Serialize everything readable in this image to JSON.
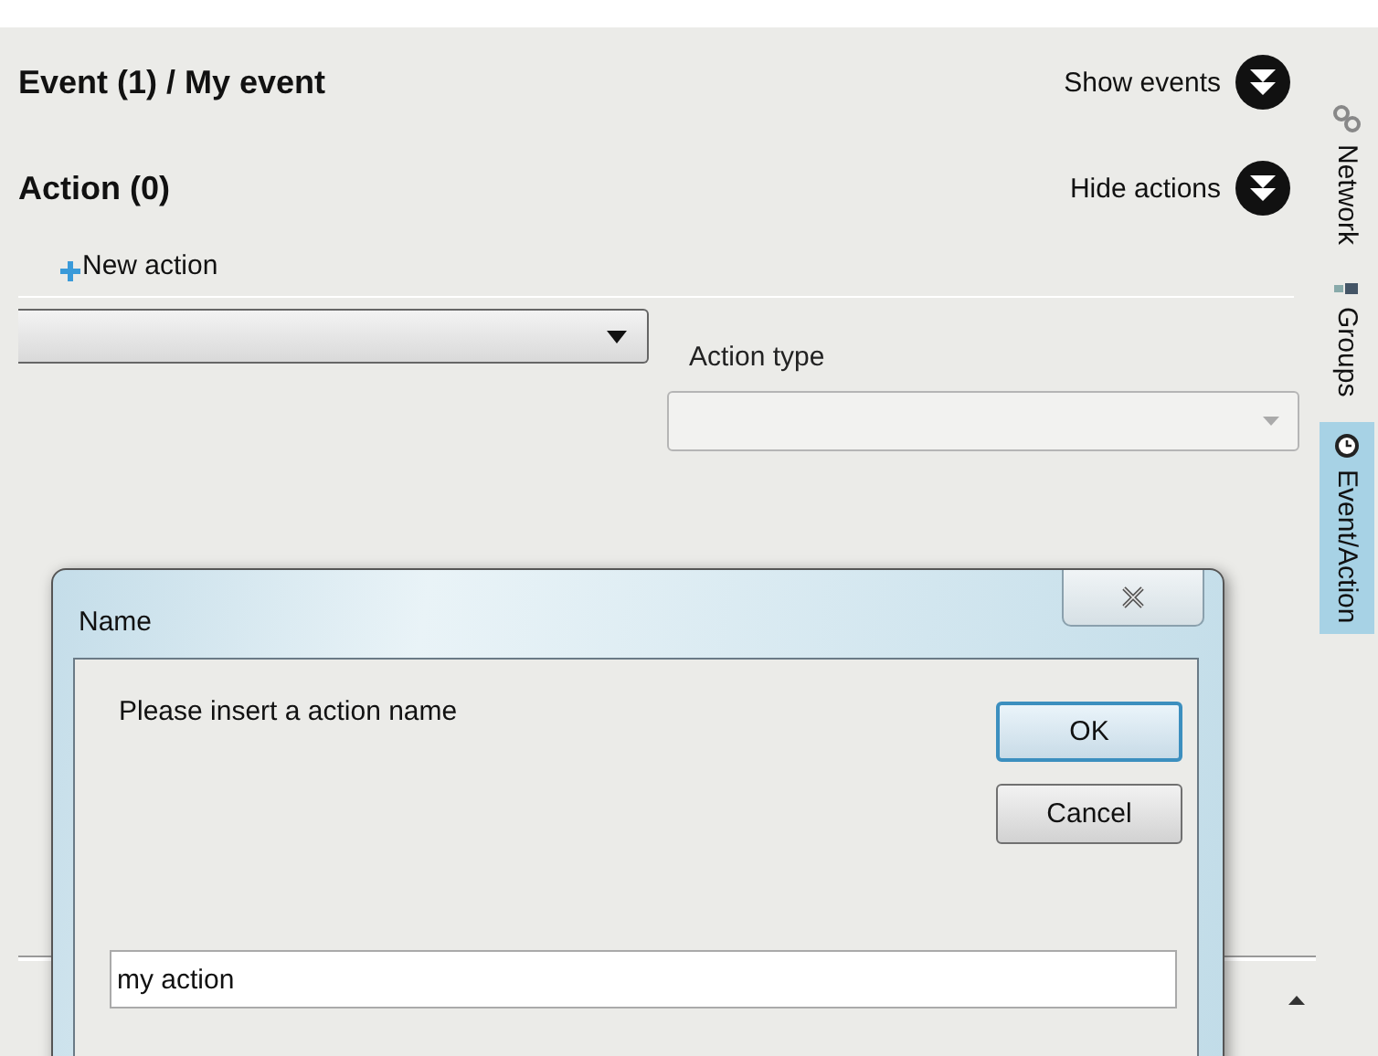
{
  "header": {
    "title": "Event (1) / My event",
    "toggle": "Show events"
  },
  "actions": {
    "title": "Action (0)",
    "toggle": "Hide actions",
    "new_action": "New action",
    "action_type_label": "Action type"
  },
  "side_tabs": [
    {
      "label": "Network",
      "selected": false
    },
    {
      "label": "Groups",
      "selected": false
    },
    {
      "label": "Event/Action",
      "selected": true
    }
  ],
  "dialog": {
    "title": "Name",
    "prompt": "Please insert a action name",
    "value": "my action",
    "buttons": [
      {
        "label": "OK",
        "default": true
      },
      {
        "label": "Cancel",
        "default": false
      }
    ]
  }
}
